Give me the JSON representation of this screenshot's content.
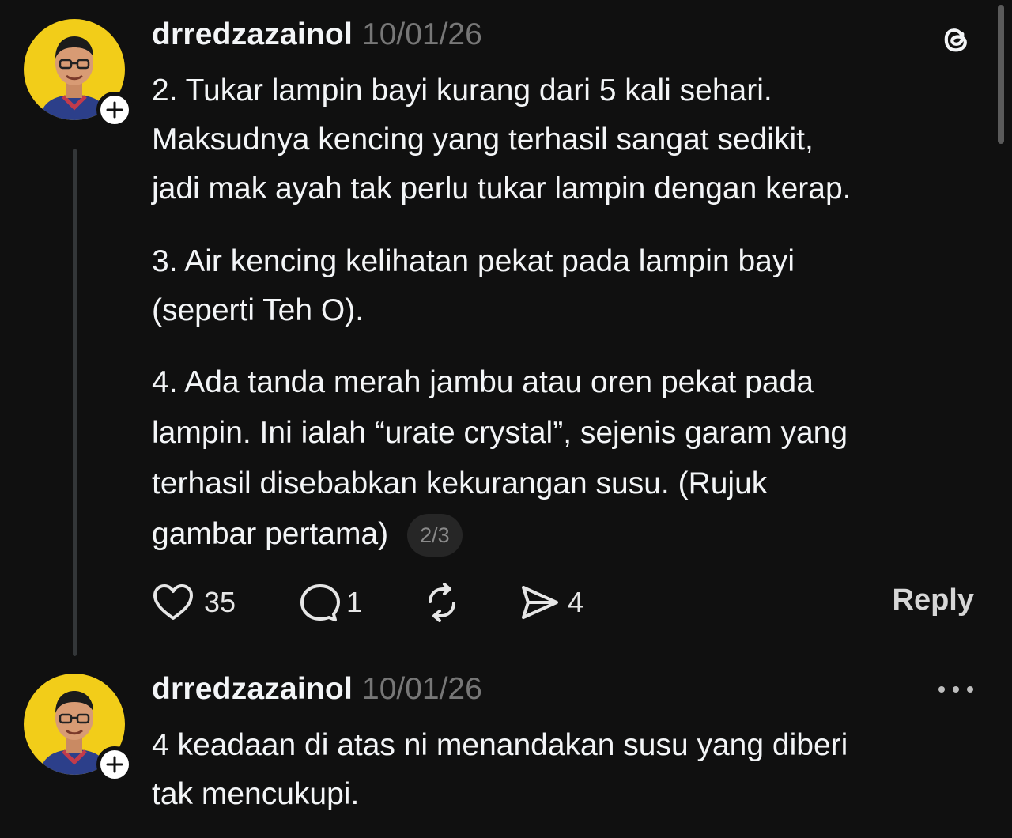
{
  "posts": [
    {
      "username": "drredzazainol",
      "date": "10/01/26",
      "paragraphs": [
        "2. Tukar lampin bayi kurang dari 5 kali sehari.\nMaksudnya kencing yang terhasil sangat sedikit,\njadi mak ayah tak perlu tukar lampin dengan kerap.",
        "3. Air kencing kelihatan pekat pada lampin bayi\n(seperti Teh O).",
        "4. Ada tanda merah jambu atau oren pekat pada\nlampin. Ini ialah “urate crystal”, sejenis garam yang\nterhasil disebabkan kekurangan susu. (Rujuk\ngambar pertama)"
      ],
      "page_indicator": "2/3",
      "likes": "35",
      "comments": "1",
      "shares": "4",
      "reply_label": "Reply"
    },
    {
      "username": "drredzazainol",
      "date": "10/01/26",
      "paragraphs": [
        "4 keadaan di atas ni menandakan susu yang diberi\ntak mencukupi."
      ]
    }
  ],
  "icons": {
    "app_logo": "threads-logo-icon",
    "like": "heart-icon",
    "comment": "comment-bubble-icon",
    "repost": "repost-icon",
    "share": "send-icon",
    "more": "more-options-icon",
    "follow": "plus-icon"
  },
  "colors": {
    "background": "#101010",
    "text": "#f3f5f7",
    "muted": "#777777",
    "avatar_bg": "#f2cd19"
  }
}
